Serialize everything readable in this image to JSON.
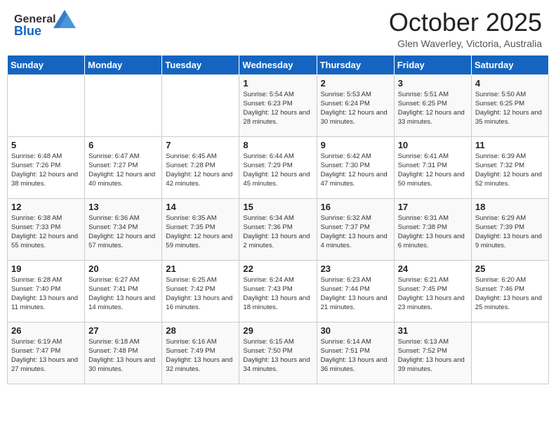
{
  "header": {
    "logo_general": "General",
    "logo_blue": "Blue",
    "month": "October 2025",
    "location": "Glen Waverley, Victoria, Australia"
  },
  "days_of_week": [
    "Sunday",
    "Monday",
    "Tuesday",
    "Wednesday",
    "Thursday",
    "Friday",
    "Saturday"
  ],
  "weeks": [
    [
      {
        "day": "",
        "content": ""
      },
      {
        "day": "",
        "content": ""
      },
      {
        "day": "",
        "content": ""
      },
      {
        "day": "1",
        "content": "Sunrise: 5:54 AM\nSunset: 6:23 PM\nDaylight: 12 hours\nand 28 minutes."
      },
      {
        "day": "2",
        "content": "Sunrise: 5:53 AM\nSunset: 6:24 PM\nDaylight: 12 hours\nand 30 minutes."
      },
      {
        "day": "3",
        "content": "Sunrise: 5:51 AM\nSunset: 6:25 PM\nDaylight: 12 hours\nand 33 minutes."
      },
      {
        "day": "4",
        "content": "Sunrise: 5:50 AM\nSunset: 6:25 PM\nDaylight: 12 hours\nand 35 minutes."
      }
    ],
    [
      {
        "day": "5",
        "content": "Sunrise: 6:48 AM\nSunset: 7:26 PM\nDaylight: 12 hours\nand 38 minutes."
      },
      {
        "day": "6",
        "content": "Sunrise: 6:47 AM\nSunset: 7:27 PM\nDaylight: 12 hours\nand 40 minutes."
      },
      {
        "day": "7",
        "content": "Sunrise: 6:45 AM\nSunset: 7:28 PM\nDaylight: 12 hours\nand 42 minutes."
      },
      {
        "day": "8",
        "content": "Sunrise: 6:44 AM\nSunset: 7:29 PM\nDaylight: 12 hours\nand 45 minutes."
      },
      {
        "day": "9",
        "content": "Sunrise: 6:42 AM\nSunset: 7:30 PM\nDaylight: 12 hours\nand 47 minutes."
      },
      {
        "day": "10",
        "content": "Sunrise: 6:41 AM\nSunset: 7:31 PM\nDaylight: 12 hours\nand 50 minutes."
      },
      {
        "day": "11",
        "content": "Sunrise: 6:39 AM\nSunset: 7:32 PM\nDaylight: 12 hours\nand 52 minutes."
      }
    ],
    [
      {
        "day": "12",
        "content": "Sunrise: 6:38 AM\nSunset: 7:33 PM\nDaylight: 12 hours\nand 55 minutes."
      },
      {
        "day": "13",
        "content": "Sunrise: 6:36 AM\nSunset: 7:34 PM\nDaylight: 12 hours\nand 57 minutes."
      },
      {
        "day": "14",
        "content": "Sunrise: 6:35 AM\nSunset: 7:35 PM\nDaylight: 12 hours\nand 59 minutes."
      },
      {
        "day": "15",
        "content": "Sunrise: 6:34 AM\nSunset: 7:36 PM\nDaylight: 13 hours\nand 2 minutes."
      },
      {
        "day": "16",
        "content": "Sunrise: 6:32 AM\nSunset: 7:37 PM\nDaylight: 13 hours\nand 4 minutes."
      },
      {
        "day": "17",
        "content": "Sunrise: 6:31 AM\nSunset: 7:38 PM\nDaylight: 13 hours\nand 6 minutes."
      },
      {
        "day": "18",
        "content": "Sunrise: 6:29 AM\nSunset: 7:39 PM\nDaylight: 13 hours\nand 9 minutes."
      }
    ],
    [
      {
        "day": "19",
        "content": "Sunrise: 6:28 AM\nSunset: 7:40 PM\nDaylight: 13 hours\nand 11 minutes."
      },
      {
        "day": "20",
        "content": "Sunrise: 6:27 AM\nSunset: 7:41 PM\nDaylight: 13 hours\nand 14 minutes."
      },
      {
        "day": "21",
        "content": "Sunrise: 6:25 AM\nSunset: 7:42 PM\nDaylight: 13 hours\nand 16 minutes."
      },
      {
        "day": "22",
        "content": "Sunrise: 6:24 AM\nSunset: 7:43 PM\nDaylight: 13 hours\nand 18 minutes."
      },
      {
        "day": "23",
        "content": "Sunrise: 6:23 AM\nSunset: 7:44 PM\nDaylight: 13 hours\nand 21 minutes."
      },
      {
        "day": "24",
        "content": "Sunrise: 6:21 AM\nSunset: 7:45 PM\nDaylight: 13 hours\nand 23 minutes."
      },
      {
        "day": "25",
        "content": "Sunrise: 6:20 AM\nSunset: 7:46 PM\nDaylight: 13 hours\nand 25 minutes."
      }
    ],
    [
      {
        "day": "26",
        "content": "Sunrise: 6:19 AM\nSunset: 7:47 PM\nDaylight: 13 hours\nand 27 minutes."
      },
      {
        "day": "27",
        "content": "Sunrise: 6:18 AM\nSunset: 7:48 PM\nDaylight: 13 hours\nand 30 minutes."
      },
      {
        "day": "28",
        "content": "Sunrise: 6:16 AM\nSunset: 7:49 PM\nDaylight: 13 hours\nand 32 minutes."
      },
      {
        "day": "29",
        "content": "Sunrise: 6:15 AM\nSunset: 7:50 PM\nDaylight: 13 hours\nand 34 minutes."
      },
      {
        "day": "30",
        "content": "Sunrise: 6:14 AM\nSunset: 7:51 PM\nDaylight: 13 hours\nand 36 minutes."
      },
      {
        "day": "31",
        "content": "Sunrise: 6:13 AM\nSunset: 7:52 PM\nDaylight: 13 hours\nand 39 minutes."
      },
      {
        "day": "",
        "content": ""
      }
    ]
  ]
}
